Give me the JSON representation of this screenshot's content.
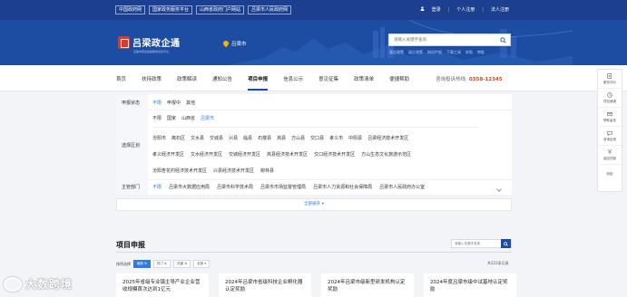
{
  "topbar": {
    "links": [
      "中国政府网",
      "国家政务服务平台",
      "山西省政府门户网站",
      "吕梁市人民政府网"
    ],
    "login": "登录",
    "personal_register": "个人注册",
    "corp_register": "法人注册"
  },
  "header": {
    "logo_text": "吕梁政企通",
    "logo_sub": "吕梁市惠企政策服务综合平台",
    "city": "吕梁市",
    "search_placeholder": "请输入关键字查询",
    "hotwords": [
      "惠企政策",
      "留企政策",
      "知识产权",
      "下载工具",
      "补贴",
      "审批"
    ]
  },
  "nav": {
    "items": [
      "首页",
      "扶持政策",
      "政策解读",
      "通知公告",
      "项目申报",
      "信息公示",
      "意见征集",
      "政策清单",
      "便捷帮助"
    ],
    "active_index": 4,
    "hotline_label": "咨询投诉热线:",
    "hotline_number": "0358-12345"
  },
  "filter": {
    "status_label": "申报状态",
    "status_options": [
      "不限",
      "申报中",
      "其他"
    ],
    "status_selected": 0,
    "region_label": "选择区划",
    "region_level_options": [
      "不限",
      "国家",
      "山西省",
      "吕梁市"
    ],
    "region_level_selected": 3,
    "region_row1": [
      "汾阳市",
      "离石区",
      "文水县",
      "交城县",
      "兴县",
      "临县",
      "石楼县",
      "岚县",
      "方山县",
      "交口县",
      "孝义市",
      "中阳县",
      "吕梁经济技术开发区"
    ],
    "region_row2": [
      "孝义经济开发区",
      "文水经济开发区",
      "交城经济开发区",
      "岚县经济技术开发区",
      "交口经济技术开发区",
      "方山生态文化旅游示范区"
    ],
    "region_row3": [
      "汾阳杏花村经济技术开发区",
      "兴县经济技术开发区",
      "柳林县"
    ],
    "dept_label": "主管部门",
    "dept_options": [
      "不限",
      "吕梁市大数据应用局",
      "吕梁市科学技术局",
      "吕梁市市场监督管理局",
      "吕梁市人力资源和社会保障局",
      "吕梁市人民政府办公室"
    ],
    "dept_selected": 0,
    "expand_label": "全部展开"
  },
  "projects": {
    "title": "项目申报",
    "search_placeholder": "请输入关键字查询",
    "sort_label": "排序选择",
    "sort_options": [
      "最新",
      "热门",
      "热度",
      "全部"
    ],
    "sort_selected": 0,
    "total": "共222条记录",
    "cards": [
      "2025年省级专业镇主导产业企业营收规模首次达到1亿元",
      "2024年吕梁市省级科技企业孵化器认定奖励",
      "2024年吕梁市级新型研发机构认定奖励",
      "2024年度吕梁市级中试基地认定奖励"
    ]
  },
  "tools": [
    "服务评价",
    "项目速递",
    "帮助留言",
    "咨询反馈",
    "返回顶部",
    "收起"
  ],
  "watermark": "大数跨境",
  "colors": {
    "primary": "#1d4da2",
    "topbar": "#1c3f8f",
    "accent_link": "#2f7be0",
    "hotline": "#e5421a",
    "logo_red": "#d93a2b"
  }
}
